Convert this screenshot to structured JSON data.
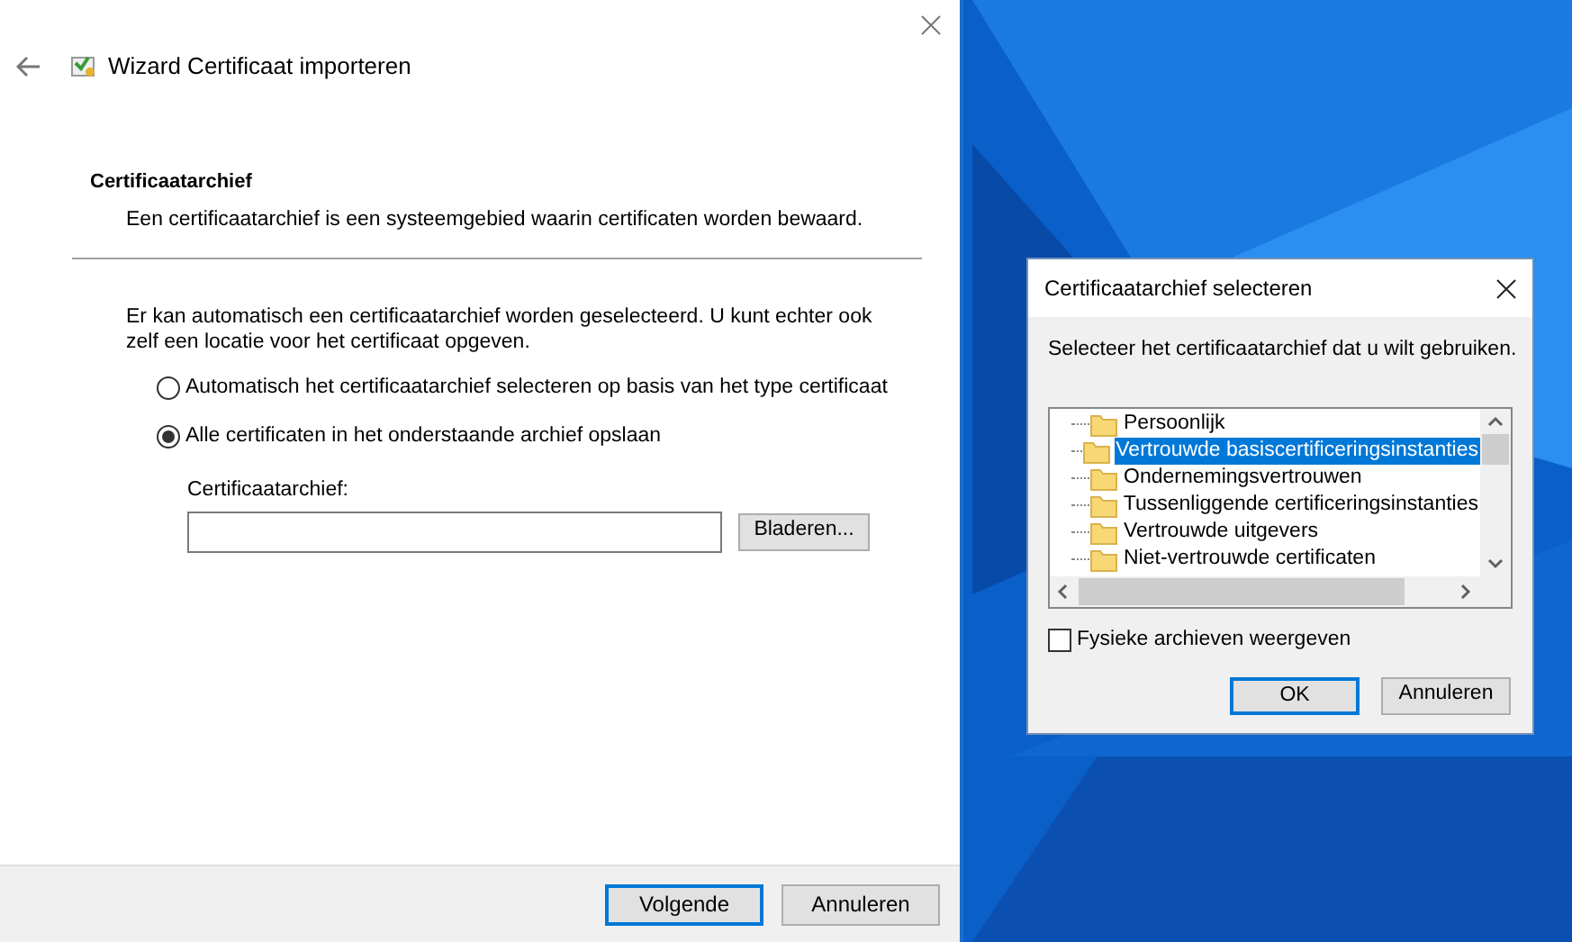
{
  "wizard": {
    "title": "Wizard Certificaat importeren",
    "heading": "Certificaatarchief",
    "description": "Een certificaatarchief is een systeemgebied waarin certificaten worden bewaard.",
    "intro": "Er kan automatisch een certificaatarchief worden geselecteerd. U kunt echter ook zelf een locatie voor het certificaat opgeven.",
    "options": [
      {
        "label": "Automatisch het certificaatarchief selecteren op basis van het type certificaat",
        "selected": false
      },
      {
        "label": "Alle certificaten in het onderstaande archief opslaan",
        "selected": true
      }
    ],
    "store_label": "Certificaatarchief:",
    "browse_button": "Bladeren...",
    "buttons": [
      {
        "label": "Volgende",
        "default": true
      },
      {
        "label": "Annuleren",
        "default": false
      }
    ]
  },
  "dialog": {
    "title": "Certificaatarchief selecteren",
    "prompt": "Selecteer het certificaatarchief dat u wilt gebruiken.",
    "stores": [
      {
        "label": "Persoonlijk",
        "selected": false
      },
      {
        "label": "Vertrouwde basiscertificeringsinstanties",
        "selected": true
      },
      {
        "label": "Ondernemingsvertrouwen",
        "selected": false
      },
      {
        "label": "Tussenliggende certificeringsinstanties",
        "selected": false
      },
      {
        "label": "Vertrouwde uitgevers",
        "selected": false
      },
      {
        "label": "Niet-vertrouwde certificaten",
        "selected": false
      }
    ],
    "show_physical": {
      "label": "Fysieke archieven weergeven",
      "checked": false
    },
    "buttons": [
      {
        "label": "OK",
        "default": true
      },
      {
        "label": "Annuleren",
        "default": false
      }
    ]
  }
}
